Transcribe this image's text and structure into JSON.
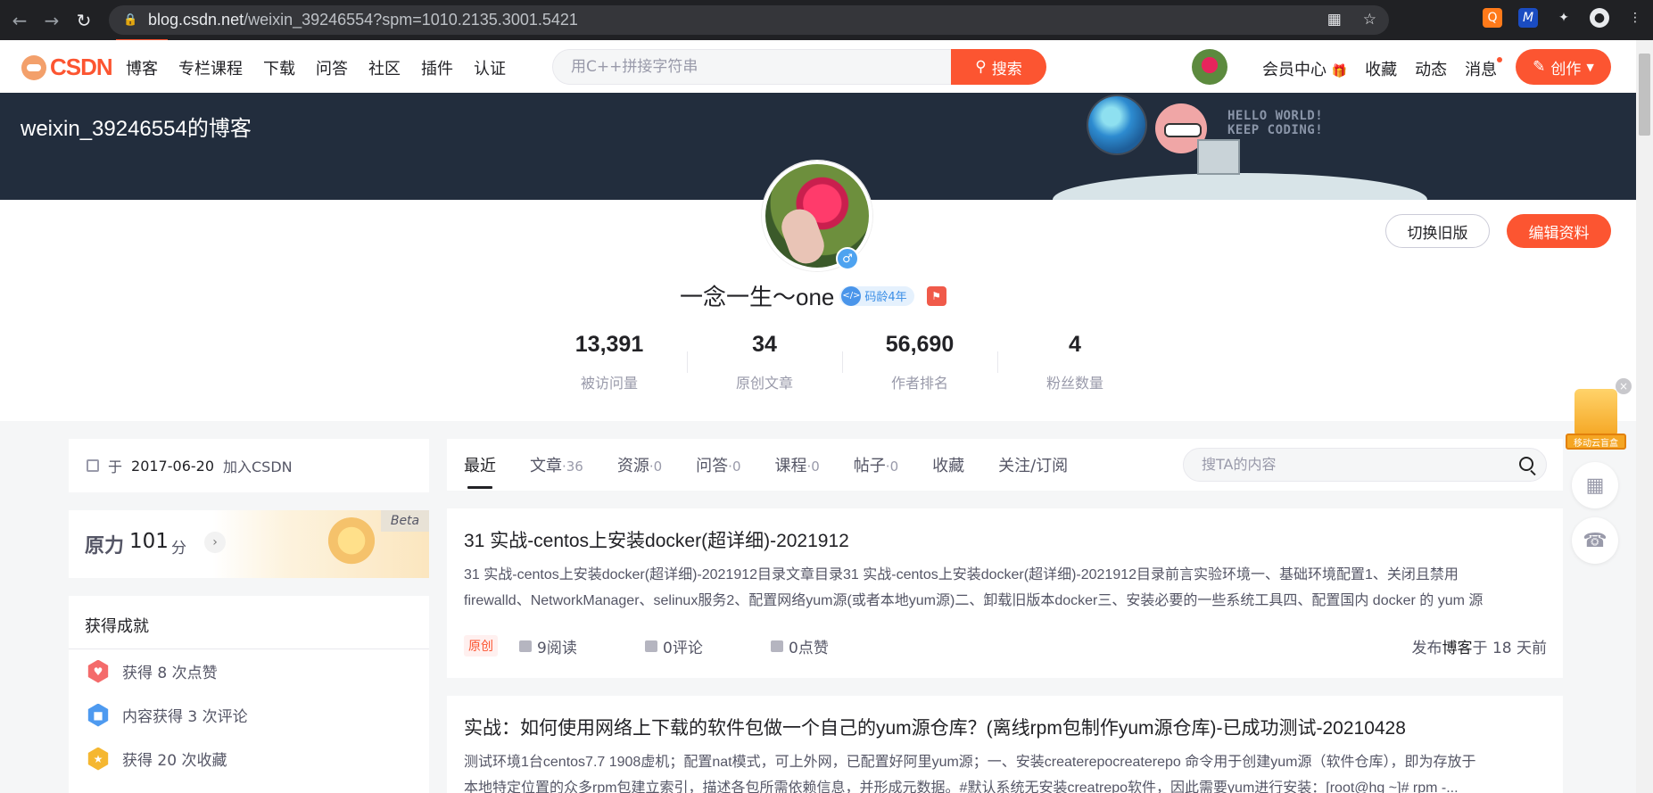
{
  "browser": {
    "url_host": "blog.csdn.net",
    "url_path": "/weixin_39246554?spm=1010.2135.3001.5421"
  },
  "toolbar": {
    "logo": "CSDN",
    "nav": [
      "博客",
      "专栏课程",
      "下载",
      "问答",
      "社区",
      "插件",
      "认证"
    ],
    "search_placeholder": "用C++拼接字符串",
    "search_button": "搜索",
    "right_nav": [
      "会员中心",
      "收藏",
      "动态",
      "消息"
    ],
    "vip_gift": "🎁",
    "create_button": "创作"
  },
  "banner": {
    "blog_name": "weixin_39246554的博客",
    "hello": [
      "HELLO WORLD!",
      "KEEP CODING!"
    ]
  },
  "profile": {
    "nickname": "一念一生～one",
    "code_age": "码龄4年",
    "switch_old": "切换旧版",
    "edit_profile": "编辑资料",
    "stats": [
      {
        "num": "13,391",
        "label": "被访问量"
      },
      {
        "num": "34",
        "label": "原创文章"
      },
      {
        "num": "56,690",
        "label": "作者排名"
      },
      {
        "num": "4",
        "label": "粉丝数量"
      }
    ]
  },
  "sidebar": {
    "joined_prefix": "于",
    "joined_date": "2017-06-20",
    "joined_suffix": "加入CSDN",
    "yuanli": {
      "label": "原力",
      "score": "101",
      "unit": "分",
      "beta": "Beta"
    },
    "achievements": {
      "title": "获得成就",
      "items": [
        {
          "text": "获得 8 次点赞",
          "color": "#f46b6b"
        },
        {
          "text": "内容获得 3 次评论",
          "color": "#4e9af0"
        },
        {
          "text": "获得 20 次收藏",
          "color": "#f5b731"
        }
      ]
    }
  },
  "tabs": {
    "items": [
      {
        "label": "最近",
        "count": ""
      },
      {
        "label": "文章",
        "count": "·36"
      },
      {
        "label": "资源",
        "count": "·0"
      },
      {
        "label": "问答",
        "count": "·0"
      },
      {
        "label": "课程",
        "count": "·0"
      },
      {
        "label": "帖子",
        "count": "·0"
      },
      {
        "label": "收藏",
        "count": ""
      },
      {
        "label": "关注/订阅",
        "count": ""
      }
    ],
    "search_placeholder": "搜TA的内容"
  },
  "articles": [
    {
      "title": "31 实战-centos上安装docker(超详细)-2021912",
      "desc_line1": "31 实战-centos上安装docker(超详细)-2021912目录文章目录31 实战-centos上安装docker(超详细)-2021912目录前言实验环境一、基础环境配置1、关闭且禁用",
      "desc_line2": "firewalld、NetworkManager、selinux服务2、配置网络yum源(或者本地yum源)二、卸载旧版本docker三、安装必要的一些系统工具四、配置国内 docker 的 yum 源",
      "tag": "原创",
      "reads": "9阅读",
      "comments": "0评论",
      "likes": "0点赞",
      "pub_prefix": "发布",
      "pub_type": "博客",
      "pub_time": "于 18 天前"
    },
    {
      "title": "实战：如何使用网络上下载的软件包做一个自己的yum源仓库？(离线rpm包制作yum源仓库)-已成功测试-20210428",
      "desc_line1": "测试环境1台centos7.7 1908虚机；配置nat模式，可上外网，已配置好阿里yum源；一、安装createrepocreaterepo 命令用于创建yum源（软件仓库），即为存放于",
      "desc_line2": "本地特定位置的众多rpm包建立索引，描述各包所需依赖信息，并形成元数据。#默认系统无安装creatrepo软件，因此需要yum进行安装：[root@hg ~]# rpm -..."
    }
  ],
  "float": {
    "ad_text": "移动云盲盒"
  }
}
